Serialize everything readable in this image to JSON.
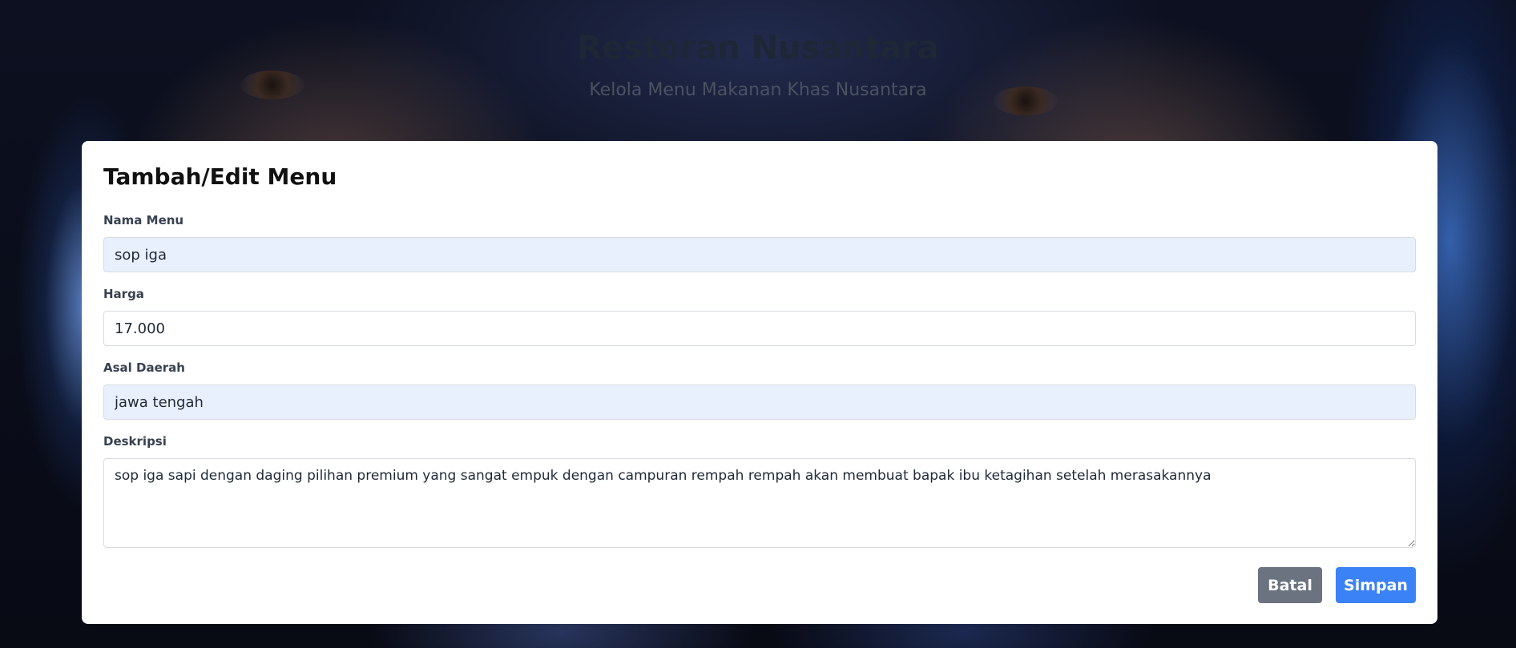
{
  "header": {
    "title": "Restoran Nusantara",
    "subtitle": "Kelola Menu Makanan Khas Nusantara"
  },
  "form": {
    "title": "Tambah/Edit Menu",
    "fields": {
      "nama_menu": {
        "label": "Nama Menu",
        "value": "sop iga"
      },
      "harga": {
        "label": "Harga",
        "value": "17.000"
      },
      "asal_daerah": {
        "label": "Asal Daerah",
        "value": "jawa tengah"
      },
      "deskripsi": {
        "label": "Deskripsi",
        "value": "sop iga sapi dengan daging pilihan premium yang sangat empuk dengan campuran rempah rempah akan membuat bapak ibu ketagihan setelah merasakannya"
      }
    },
    "buttons": {
      "cancel": "Batal",
      "save": "Simpan"
    }
  },
  "colors": {
    "cancel_button": "#6b7280",
    "save_button": "#3b82f6",
    "autofill_bg": "#e8f0fe"
  }
}
